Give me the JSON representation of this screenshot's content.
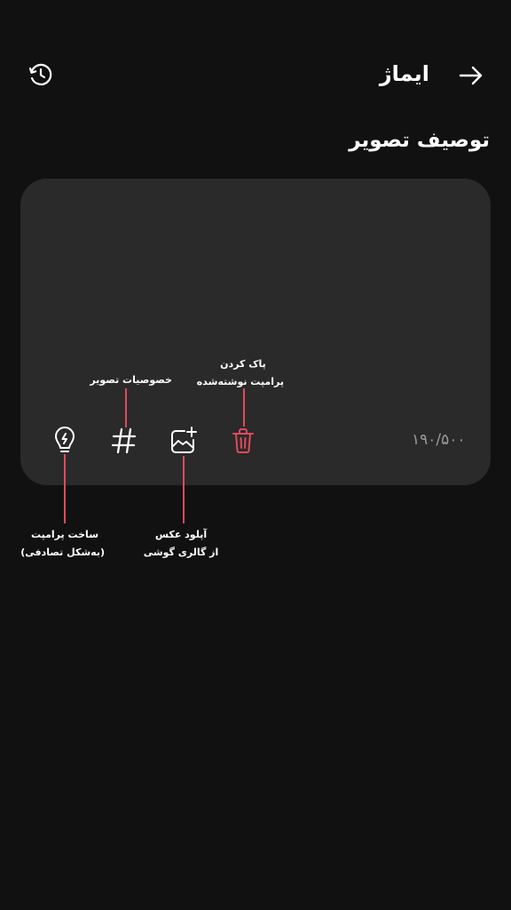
{
  "header": {
    "title": "ایماژ",
    "back_icon": "arrow-right-icon",
    "history_icon": "history-icon"
  },
  "section": {
    "title": "توصیف تصویر"
  },
  "prompt": {
    "value": "",
    "counter": "۱۹۰/۵۰۰"
  },
  "tools": [
    {
      "icon": "lightbulb-icon"
    },
    {
      "icon": "hashtag-icon"
    },
    {
      "icon": "image-plus-icon"
    },
    {
      "icon": "trash-icon"
    }
  ],
  "callouts": {
    "hash": "خصوصیات تصویر",
    "clear": [
      "پاک کردن",
      "پرامپت نوشته‌شده"
    ],
    "idea": [
      "ساخت پرامپت",
      "(به‌شکل تصادفی)"
    ],
    "upload": [
      "آپلود عکس",
      "از گالری گوشی"
    ]
  },
  "colors": {
    "background": "#111111",
    "card": "#2a2a2a",
    "accent": "#e04a5c",
    "counter": "#9a9a9a"
  }
}
